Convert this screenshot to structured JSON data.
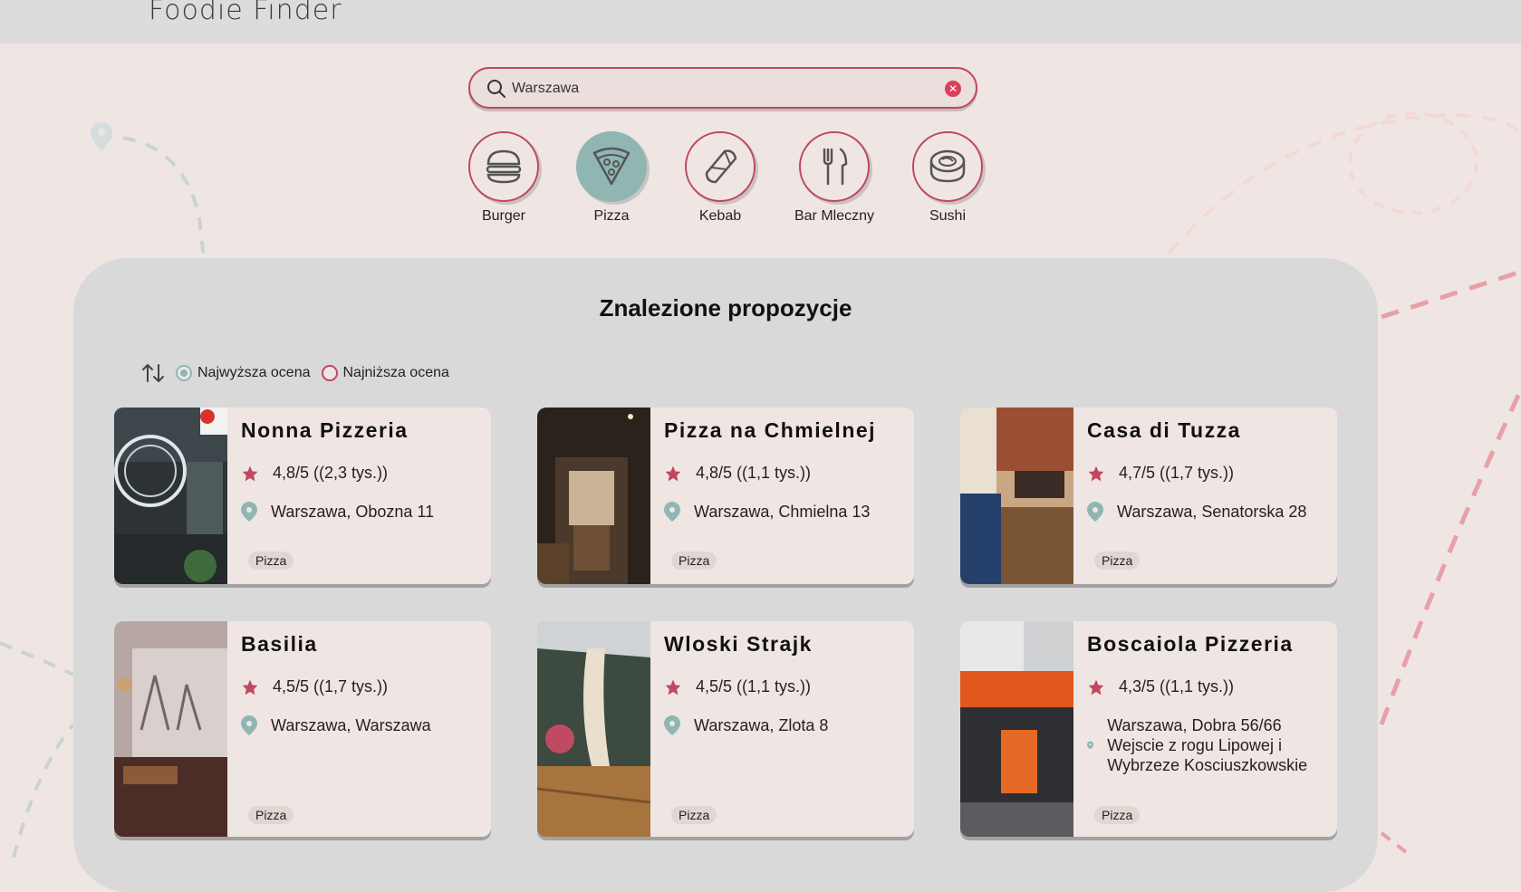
{
  "app": {
    "logo": "Foodie Finder"
  },
  "search": {
    "value": "Warszawa",
    "placeholder": ""
  },
  "categories": [
    {
      "label": "Burger",
      "icon": "burger-icon",
      "active": false
    },
    {
      "label": "Pizza",
      "icon": "pizza-icon",
      "active": true
    },
    {
      "label": "Kebab",
      "icon": "kebab-icon",
      "active": false
    },
    {
      "label": "Bar Mleczny",
      "icon": "fork-knife-icon",
      "active": false
    },
    {
      "label": "Sushi",
      "icon": "sushi-icon",
      "active": false
    }
  ],
  "results": {
    "title": "Znalezione propozycje",
    "sort": {
      "options": [
        {
          "label": "Najwyższa ocena",
          "checked": true
        },
        {
          "label": "Najniższa ocena",
          "checked": false
        }
      ]
    },
    "cards": [
      {
        "name": "Nonna Pizzeria",
        "rating": "4,8/5 ((2,3 tys.))",
        "address": "Warszawa, Obozna 11",
        "tag": "Pizza"
      },
      {
        "name": "Pizza na Chmielnej",
        "rating": "4,8/5 ((1,1 tys.))",
        "address": "Warszawa, Chmielna 13",
        "tag": "Pizza"
      },
      {
        "name": "Casa di Tuzza",
        "rating": "4,7/5 ((1,7 tys.))",
        "address": "Warszawa, Senatorska 28",
        "tag": "Pizza"
      },
      {
        "name": "Basilia",
        "rating": "4,5/5 ((1,7 tys.))",
        "address": "Warszawa, Warszawa",
        "tag": "Pizza"
      },
      {
        "name": "Wloski Strajk",
        "rating": "4,5/5 ((1,1 tys.))",
        "address": "Warszawa, Zlota 8",
        "tag": "Pizza"
      },
      {
        "name": "Boscaiola Pizzeria",
        "rating": "4,3/5 ((1,1 tys.))",
        "address": "Warszawa, Dobra 56/66 Wejscie z rogu Lipowej i Wybrzeze Kosciuszkowskie",
        "tag": "Pizza"
      }
    ]
  },
  "colors": {
    "accent": "#c0485f",
    "teal": "#8fb6b3",
    "star": "#c0485f",
    "background": "#efe6e3",
    "panel": "#d9d9d9"
  }
}
